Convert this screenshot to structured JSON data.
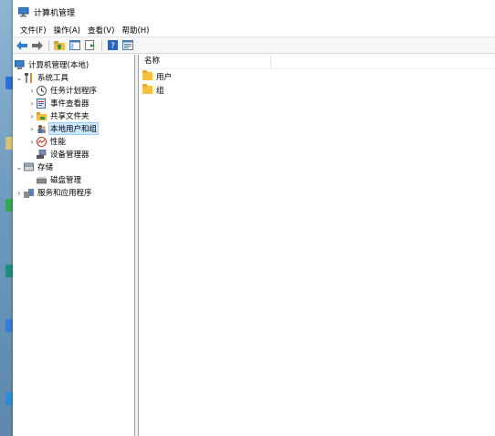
{
  "window": {
    "title": "计算机管理"
  },
  "menu": [
    "文件(F)",
    "操作(A)",
    "查看(V)",
    "帮助(H)"
  ],
  "toolbar": [
    "back-icon",
    "forward-icon",
    "up-folder-icon",
    "show-hide-tree-icon",
    "export-icon",
    "help-icon",
    "properties-icon"
  ],
  "tree": {
    "root": "计算机管理(本地)",
    "system_tools": "系统工具",
    "task_scheduler": "任务计划程序",
    "event_viewer": "事件查看器",
    "shared_folders": "共享文件夹",
    "local_users": "本地用户和组",
    "performance": "性能",
    "device_manager": "设备管理器",
    "storage": "存储",
    "disk_management": "磁盘管理",
    "services_apps": "服务和应用程序"
  },
  "list": {
    "column_name": "名称",
    "items": [
      "用户",
      "组"
    ]
  }
}
